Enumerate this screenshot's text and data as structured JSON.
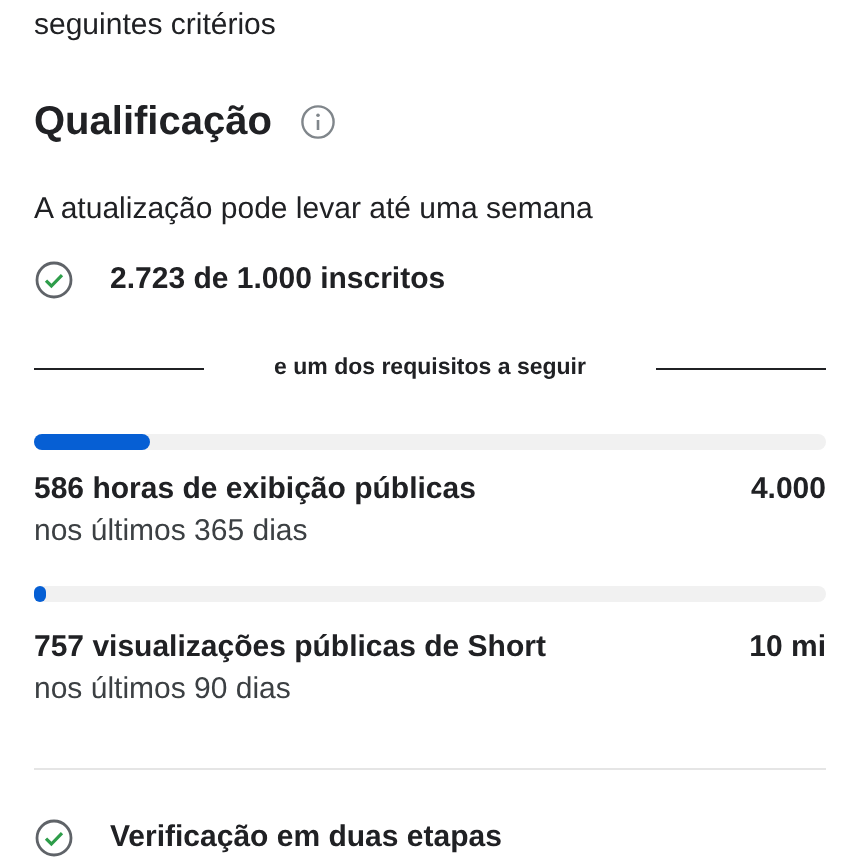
{
  "intro_tail": "seguintes critérios",
  "section": {
    "title": "Qualificação",
    "note": "A atualização pode levar até uma semana"
  },
  "base_requirement": {
    "met": true,
    "label": "2.723 de 1.000 inscritos"
  },
  "separator": "e um dos requisitos a seguir",
  "metrics": [
    {
      "level": 0.146,
      "label": "586 horas de exibição públicas",
      "period": "nos últimos 365 dias",
      "target": "4.000"
    },
    {
      "level": 0.015,
      "label": "757 visualizações públicas de Short",
      "period": "nos últimos 90 dias",
      "target": "10 mi"
    }
  ],
  "extra_requirement": {
    "met": true,
    "label": "Verificação em duas etapas"
  }
}
